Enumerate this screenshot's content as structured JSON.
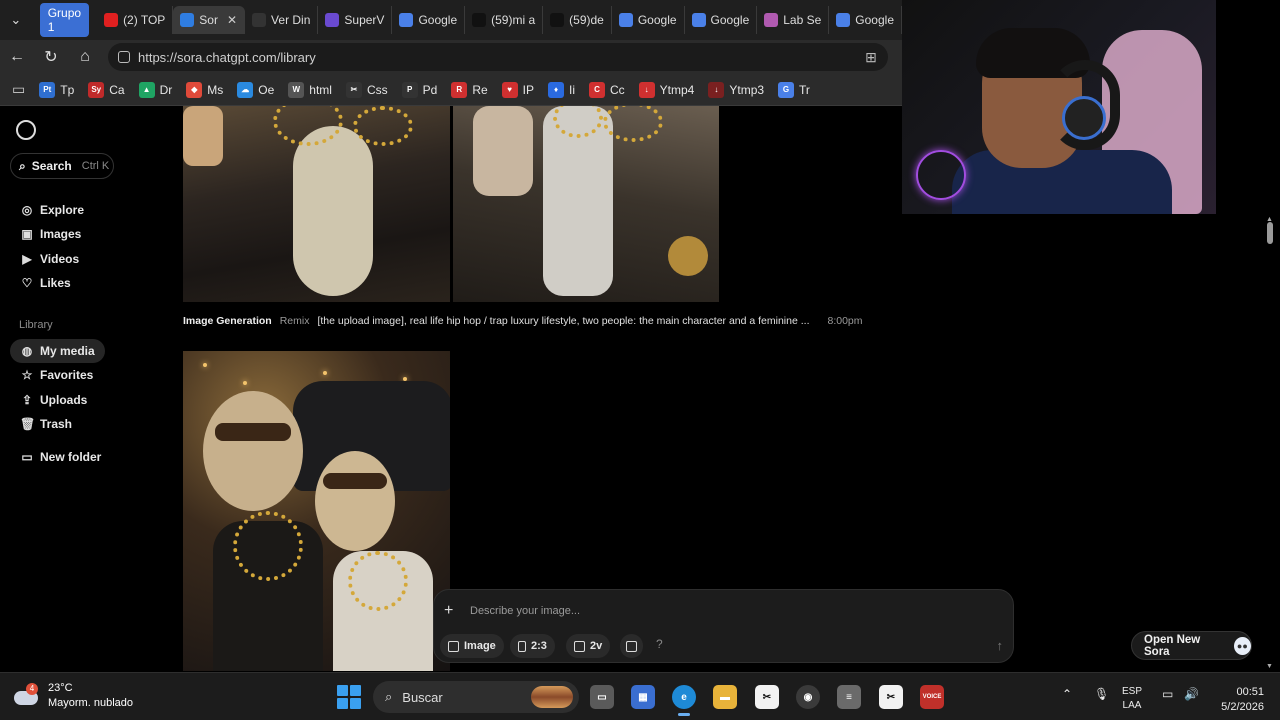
{
  "browser": {
    "group_label": "Grupo 1",
    "tabs": [
      {
        "label": "(2) TOP",
        "icon": "youtube-icon",
        "color": "#e02020"
      },
      {
        "label": "Sor",
        "icon": "sora-icon",
        "color": "#2f7de1",
        "active": true
      },
      {
        "label": "Ver Din",
        "icon": "hd-icon",
        "color": "#333333"
      },
      {
        "label": "SuperV",
        "icon": "superv-icon",
        "color": "#6a4ad0"
      },
      {
        "label": "Google",
        "icon": "google-translate-icon",
        "color": "#4a80e8"
      },
      {
        "label": "(59)mi a",
        "icon": "tiktok-icon",
        "color": "#111111"
      },
      {
        "label": "(59)de",
        "icon": "tiktok-icon",
        "color": "#111111"
      },
      {
        "label": "Google",
        "icon": "google-translate-icon",
        "color": "#4a80e8"
      },
      {
        "label": "Google",
        "icon": "google-translate-icon",
        "color": "#4a80e8"
      },
      {
        "label": "Lab Se",
        "icon": "lab-icon",
        "color": "#b05ab0"
      },
      {
        "label": "Google",
        "icon": "gemini-icon",
        "color": "#4a80e8"
      }
    ],
    "url": "https://sora.chatgpt.com/library",
    "bookmarks": [
      {
        "label": "Tp",
        "badge": "Pt",
        "color": "#2f6fd0"
      },
      {
        "label": "Ca",
        "badge": "Sy",
        "color": "#c02a2a"
      },
      {
        "label": "Dr",
        "badge": "▲",
        "color": "#1fa463"
      },
      {
        "label": "Ms",
        "badge": "◆",
        "color": "#e04a3a"
      },
      {
        "label": "Oe",
        "badge": "☁",
        "color": "#2a8ae0"
      },
      {
        "label": "html",
        "badge": "W",
        "color": "#555555"
      },
      {
        "label": "Css",
        "badge": "✂",
        "color": "#333333"
      },
      {
        "label": "Pd",
        "badge": "P",
        "color": "#333333"
      },
      {
        "label": "Re",
        "badge": "R",
        "color": "#d03030"
      },
      {
        "label": "IP",
        "badge": "♥",
        "color": "#d03030"
      },
      {
        "label": "Ii",
        "badge": "♦",
        "color": "#2a6ae0"
      },
      {
        "label": "Cc",
        "badge": "C",
        "color": "#d03030"
      },
      {
        "label": "Ytmp4",
        "badge": "↓",
        "color": "#d03030"
      },
      {
        "label": "Ytmp3",
        "badge": "↓",
        "color": "#7a2020"
      },
      {
        "label": "Tr",
        "badge": "G",
        "color": "#4a80e8"
      }
    ]
  },
  "sidebar": {
    "search_label": "Search",
    "search_shortcut": "Ctrl K",
    "items": [
      {
        "label": "Explore",
        "icon": "compass-icon"
      },
      {
        "label": "Images",
        "icon": "image-icon"
      },
      {
        "label": "Videos",
        "icon": "video-icon"
      },
      {
        "label": "Likes",
        "icon": "heart-icon"
      }
    ],
    "library_label": "Library",
    "library_items": [
      {
        "label": "My media",
        "icon": "media-icon",
        "selected": true
      },
      {
        "label": "Favorites",
        "icon": "star-icon"
      },
      {
        "label": "Uploads",
        "icon": "upload-icon"
      },
      {
        "label": "Trash",
        "icon": "trash-icon"
      }
    ],
    "new_folder_label": "New folder"
  },
  "feed": {
    "item": {
      "type": "Image Generation",
      "mode": "Remix",
      "prompt": "[the upload image], real life hip hop / trap luxury lifestyle, two people: the main character and a feminine ...",
      "time": "8:00pm"
    }
  },
  "composer": {
    "placeholder": "Describe your image...",
    "type_label": "Image",
    "ratio_label": "2:3",
    "variations_label": "2v",
    "help_label": "?"
  },
  "open_new_sora_label": "Open New Sora",
  "taskbar": {
    "temperature": "23°C",
    "weather": "Mayorm. nublado",
    "weather_badge": "4",
    "search_label": "Buscar",
    "lang_top": "ESP",
    "lang_bottom": "LAA",
    "time": "00:51",
    "date": "5/2/2026"
  }
}
